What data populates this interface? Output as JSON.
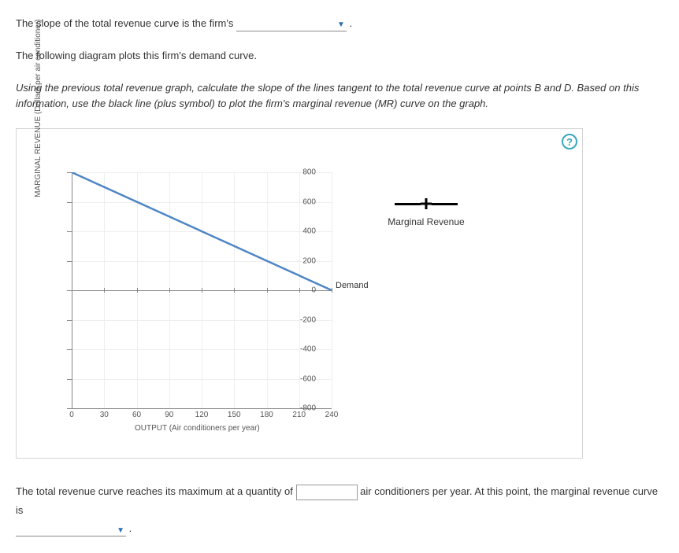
{
  "question1_pre": "The slope of the total revenue curve is the firm's ",
  "question1_post": " .",
  "question2": "The following diagram plots this firm's demand curve.",
  "instruction": "Using the previous total revenue graph, calculate the slope of the lines tangent to the total revenue curve at points B and D. Based on this information, use the black line (plus symbol) to plot the firm's marginal revenue (MR) curve on the graph.",
  "help_label": "?",
  "y_axis_title": "MARGINAL REVENUE (Dollars per air conditioner)",
  "x_axis_title": "OUTPUT (Air conditioners per year)",
  "demand_label": "Demand",
  "legend_label": "Marginal Revenue",
  "footer_pre": "The total revenue curve reaches its maximum at a quantity of ",
  "footer_mid": " air conditioners per year. At this point, the marginal revenue curve is ",
  "footer_post": " .",
  "y_ticks": {
    "t0": "800",
    "t1": "600",
    "t2": "400",
    "t3": "200",
    "t4": "0",
    "t5": "-200",
    "t6": "-400",
    "t7": "-600",
    "t8": "-800"
  },
  "x_ticks": {
    "t0": "0",
    "t1": "30",
    "t2": "60",
    "t3": "90",
    "t4": "120",
    "t5": "150",
    "t6": "180",
    "t7": "210",
    "t8": "240"
  },
  "chart_data": {
    "type": "line",
    "title": "",
    "xlabel": "OUTPUT (Air conditioners per year)",
    "ylabel": "MARGINAL REVENUE (Dollars per air conditioner)",
    "xlim": [
      0,
      240
    ],
    "ylim": [
      -800,
      800
    ],
    "series": [
      {
        "name": "Demand",
        "color": "#4f86c6",
        "x": [
          0,
          240
        ],
        "y": [
          800,
          0
        ]
      }
    ],
    "legend_items": [
      {
        "name": "Marginal Revenue",
        "symbol": "plus",
        "color": "#000"
      }
    ]
  }
}
